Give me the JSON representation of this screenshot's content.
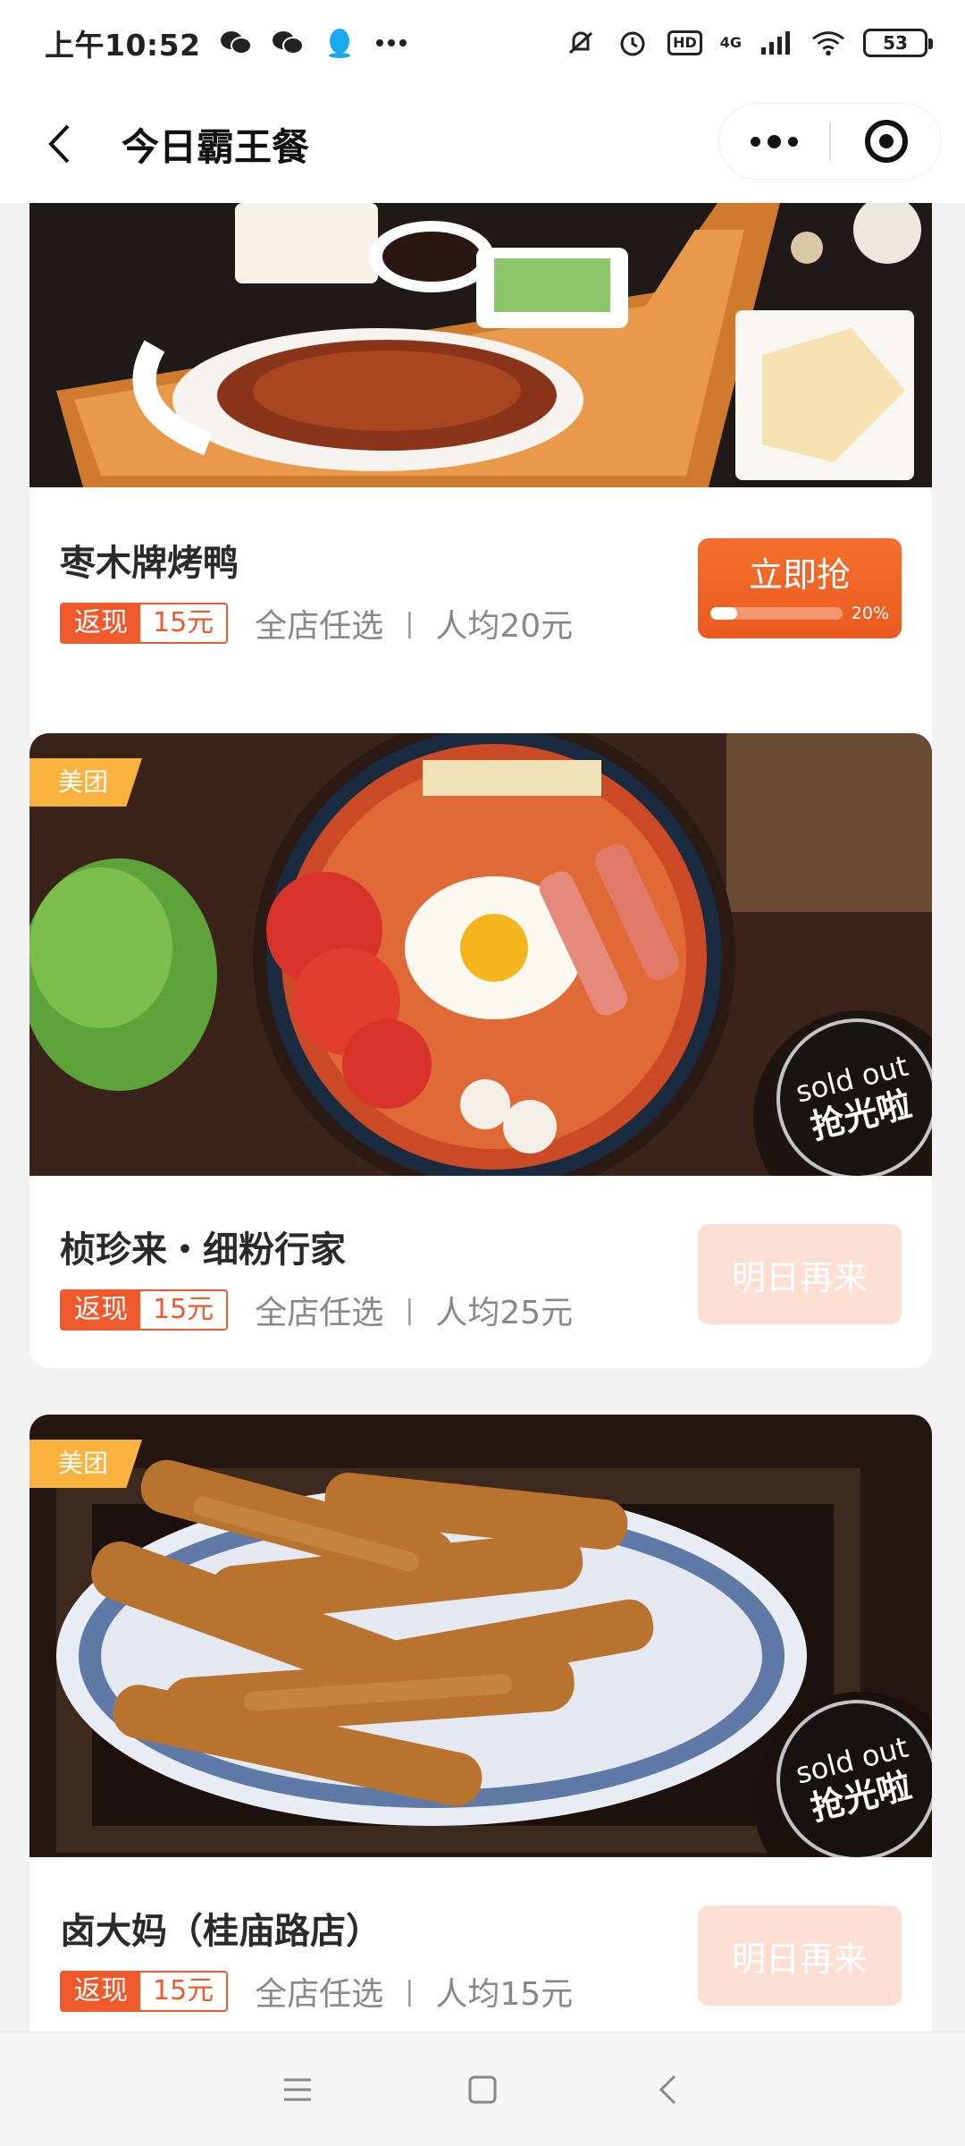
{
  "status_bar": {
    "time": "上午10:52",
    "hd": "HD",
    "network": "4G",
    "battery": "53"
  },
  "nav": {
    "title": "今日霸王餐"
  },
  "cards": [
    {
      "name": "枣木牌烤鸭",
      "tag_left": "返现",
      "tag_right": "15元",
      "scope": "全店任选",
      "separator": "|",
      "avg": "人均20元",
      "button": "立即抢",
      "progress_text": "20%",
      "progress": 0.2
    },
    {
      "badge": "美团",
      "name": "桢珍来・细粉行家",
      "tag_left": "返现",
      "tag_right": "15元",
      "scope": "全店任选",
      "separator": "|",
      "avg": "人均25元",
      "button": "明日再来",
      "soldout_en": "sold out",
      "soldout_cn": "抢光啦"
    },
    {
      "badge": "美团",
      "name": "卤大妈（桂庙路店）",
      "tag_left": "返现",
      "tag_right": "15元",
      "scope": "全店任选",
      "separator": "|",
      "avg": "人均15元",
      "button": "明日再来",
      "soldout_en": "sold out",
      "soldout_cn": "抢光啦"
    }
  ],
  "colors": {
    "accent": "#ee5a2b",
    "badge": "#f9b23d",
    "disabled_button": "#fde0d3"
  }
}
